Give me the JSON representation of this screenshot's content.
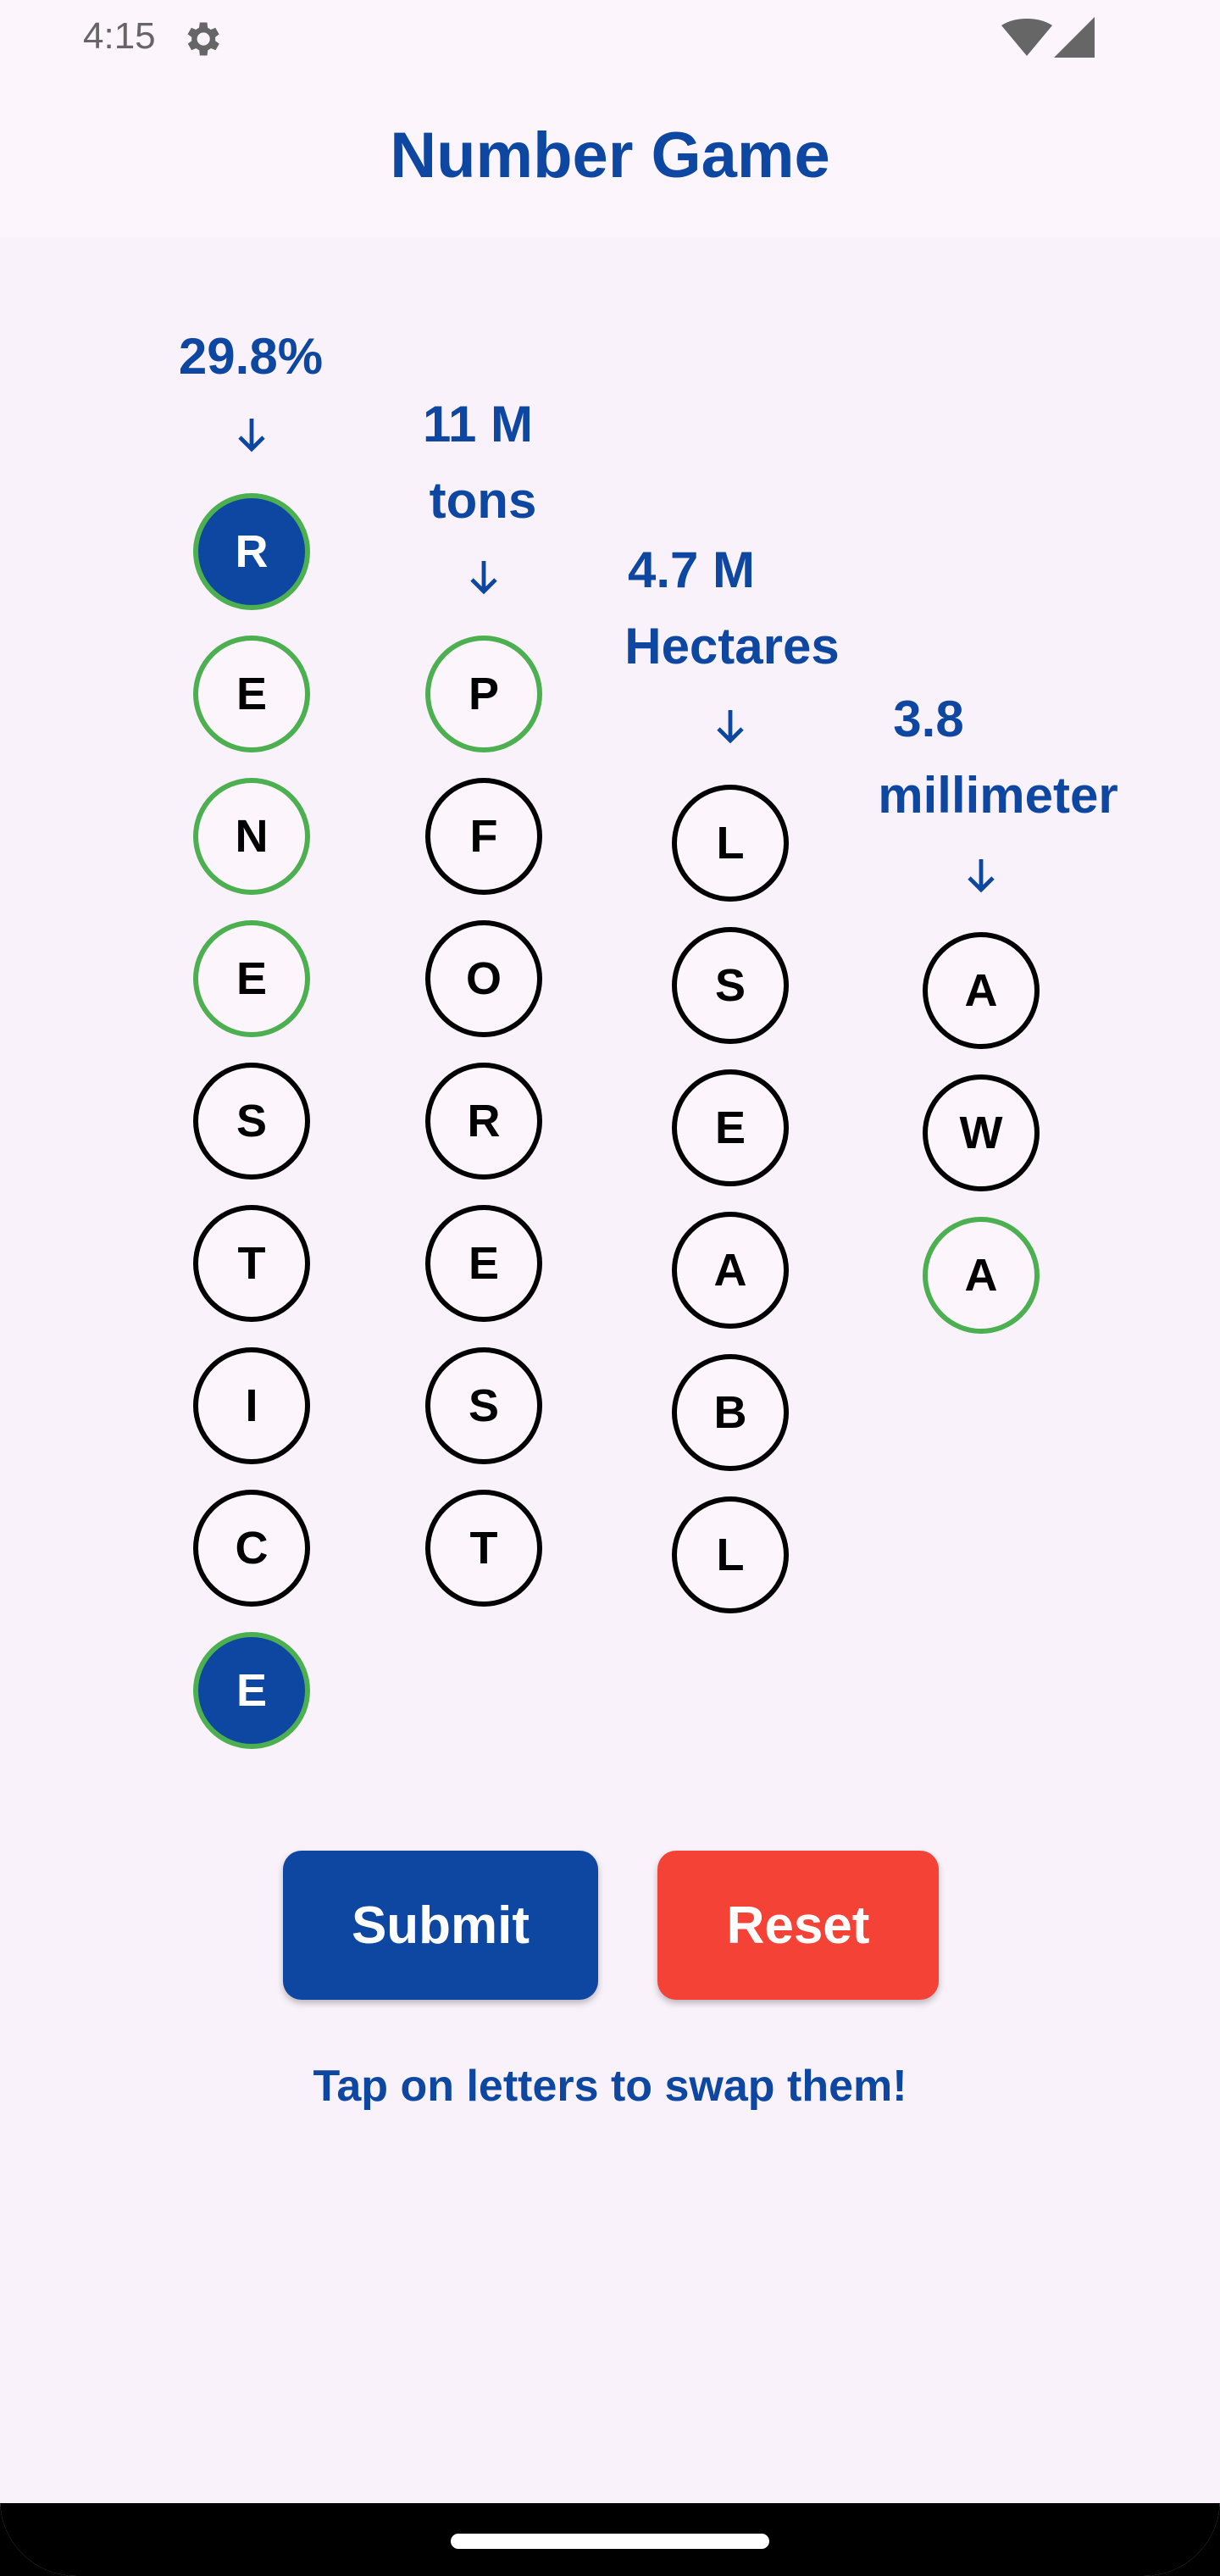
{
  "status_bar": {
    "time": "4:15"
  },
  "app_bar": {
    "title": "Number Game"
  },
  "columns": [
    {
      "label_line1": "29.8%",
      "label_line2": "",
      "letters": [
        {
          "ch": "R",
          "state": "filled"
        },
        {
          "ch": "E",
          "state": "green"
        },
        {
          "ch": "N",
          "state": "green"
        },
        {
          "ch": "E",
          "state": "green"
        },
        {
          "ch": "S",
          "state": "normal"
        },
        {
          "ch": "T",
          "state": "normal"
        },
        {
          "ch": "I",
          "state": "normal"
        },
        {
          "ch": "C",
          "state": "normal"
        },
        {
          "ch": "E",
          "state": "filled"
        }
      ]
    },
    {
      "label_line1": "11 M",
      "label_line2": "tons",
      "letters": [
        {
          "ch": "P",
          "state": "green"
        },
        {
          "ch": "F",
          "state": "normal"
        },
        {
          "ch": "O",
          "state": "normal"
        },
        {
          "ch": "R",
          "state": "normal"
        },
        {
          "ch": "E",
          "state": "normal"
        },
        {
          "ch": "S",
          "state": "normal"
        },
        {
          "ch": "T",
          "state": "normal"
        }
      ]
    },
    {
      "label_line1": "4.7 M",
      "label_line2": "Hectares",
      "letters": [
        {
          "ch": "L",
          "state": "normal"
        },
        {
          "ch": "S",
          "state": "normal"
        },
        {
          "ch": "E",
          "state": "normal"
        },
        {
          "ch": "A",
          "state": "normal"
        },
        {
          "ch": "B",
          "state": "normal"
        },
        {
          "ch": "L",
          "state": "normal"
        }
      ]
    },
    {
      "label_line1": "3.8",
      "label_line2": "millimeter",
      "letters": [
        {
          "ch": "A",
          "state": "normal"
        },
        {
          "ch": "W",
          "state": "normal"
        },
        {
          "ch": "A",
          "state": "green"
        }
      ]
    }
  ],
  "actions": {
    "submit_label": "Submit",
    "reset_label": "Reset"
  },
  "hint": "Tap on letters to swap them!",
  "colors": {
    "primary": "#0D47A1",
    "accent_green": "#4CAF50",
    "reset_red": "#F44336"
  },
  "icons": {
    "status_left": "gear-icon",
    "status_right": [
      "wifi-icon",
      "signal-icon"
    ],
    "column_pointer": "arrow-down-icon"
  }
}
